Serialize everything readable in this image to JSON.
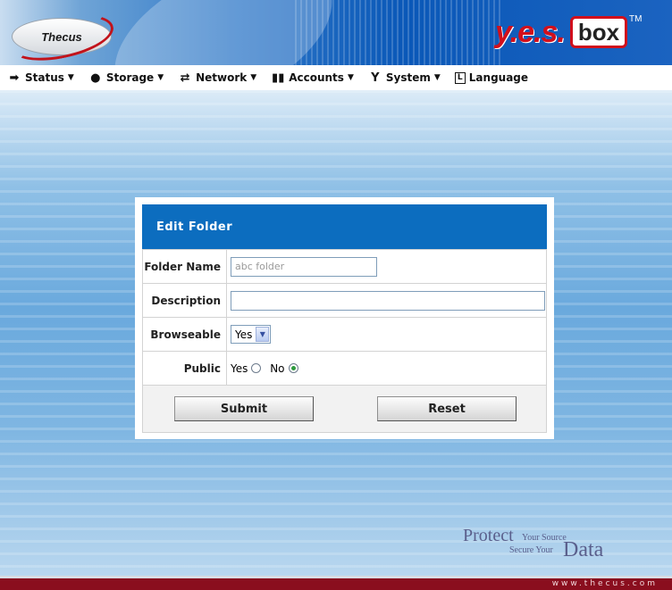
{
  "brand": {
    "thecus": "Thecus",
    "yes": "y.e.s.",
    "box": "box",
    "tm": "TM"
  },
  "menu": [
    {
      "label": "Status",
      "icon": "arrow-icon"
    },
    {
      "label": "Storage",
      "icon": "disk-icon"
    },
    {
      "label": "Network",
      "icon": "network-icon"
    },
    {
      "label": "Accounts",
      "icon": "accounts-icon"
    },
    {
      "label": "System",
      "icon": "wrench-icon"
    },
    {
      "label": "Language",
      "icon": "language-icon"
    }
  ],
  "dialog": {
    "title": "Edit Folder",
    "fields": {
      "folder_name_label": "Folder Name",
      "folder_name_value": "abc folder",
      "description_label": "Description",
      "description_value": "",
      "browseable_label": "Browseable",
      "browseable_value": "Yes",
      "public_label": "Public",
      "public_yes": "Yes",
      "public_no": "No",
      "public_selected": "No"
    },
    "submit_label": "Submit",
    "reset_label": "Reset"
  },
  "tagline": {
    "protect": "Protect",
    "your_source": "Your Source",
    "secure_your": "Secure Your",
    "data": "Data"
  },
  "footer": {
    "url": "www.thecus.com"
  },
  "colors": {
    "title_bar": "#0c6dbf",
    "footer": "#8a0e1e",
    "radio_selected": "#2e9a3e"
  }
}
